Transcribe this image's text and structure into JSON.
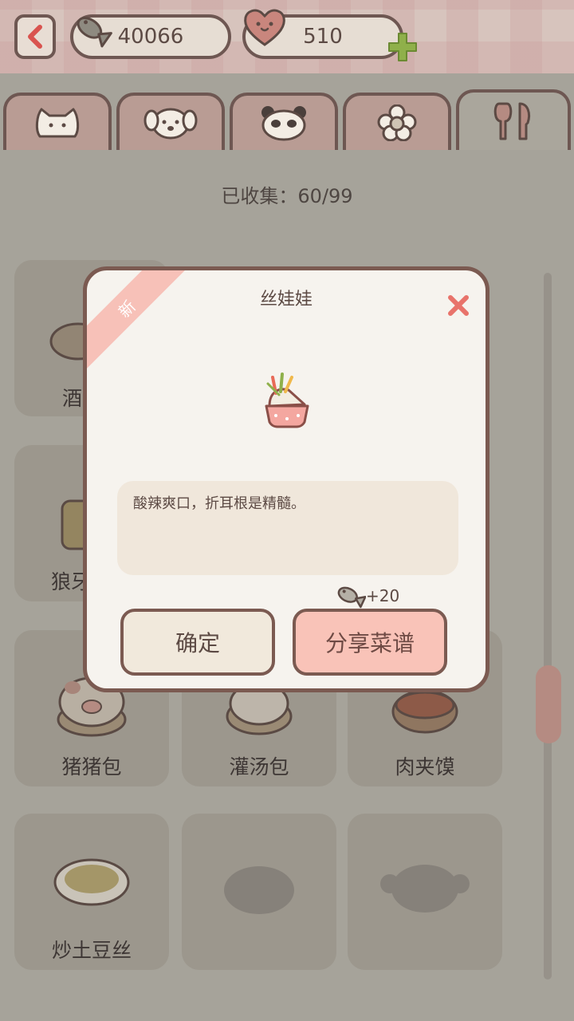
{
  "header": {
    "coins": "40066",
    "hearts": "510"
  },
  "tabs": [
    {
      "name": "cat",
      "active": false
    },
    {
      "name": "dog",
      "active": false
    },
    {
      "name": "panda",
      "active": false
    },
    {
      "name": "flower",
      "active": false
    },
    {
      "name": "food",
      "active": true
    }
  ],
  "collection": {
    "collected_text": "已收集：60/99"
  },
  "cards": [
    {
      "label": "猪猪包"
    },
    {
      "label": "灌汤包"
    },
    {
      "label": "肉夹馍"
    },
    {
      "label": "炒土豆丝"
    },
    {
      "label": ""
    },
    {
      "label": ""
    }
  ],
  "partial_labels": {
    "row1": "酒",
    "row2": "狼牙"
  },
  "dialog": {
    "ribbon": "新",
    "title": "丝娃娃",
    "description": "酸辣爽口，折耳根是精髓。",
    "reward": "+20",
    "confirm_label": "确定",
    "share_label": "分享菜谱"
  },
  "colors": {
    "accent_pink": "#f9c3b8",
    "border_brown": "#7b5a51",
    "plus_green": "#8fb04a",
    "close_red": "#e8736b"
  }
}
